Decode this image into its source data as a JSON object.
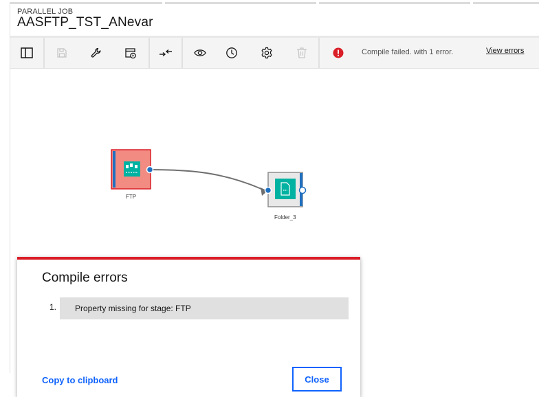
{
  "header": {
    "job_type": "PARALLEL JOB",
    "job_name": "AASFTP_TST_ANevar"
  },
  "toolbar": {
    "buttons": [
      {
        "name": "toggle-panel",
        "icon": "panel-left-icon"
      },
      {
        "name": "save",
        "icon": "save-icon",
        "disabled": true
      },
      {
        "name": "settings-wrench",
        "icon": "wrench-icon"
      },
      {
        "name": "compile-run",
        "icon": "run-job-icon"
      },
      {
        "name": "arrange",
        "icon": "arrows-compress-icon"
      },
      {
        "name": "preview",
        "icon": "eye-icon"
      },
      {
        "name": "schedule",
        "icon": "clock-icon"
      },
      {
        "name": "job-settings",
        "icon": "gear-icon"
      },
      {
        "name": "delete",
        "icon": "trash-icon",
        "disabled": true
      }
    ],
    "status_icon": "error-icon",
    "status_text": "Compile failed. with 1 error.",
    "view_errors_label": "View errors"
  },
  "canvas": {
    "nodes": [
      {
        "id": "ftp",
        "label": "FTP",
        "status": "error",
        "icon": "ftp-stage-icon"
      },
      {
        "id": "folder3",
        "label": "Folder_3",
        "status": "ok",
        "icon": "file-icon"
      }
    ],
    "links": [
      {
        "from": "ftp",
        "to": "folder3"
      }
    ]
  },
  "dialog": {
    "title": "Compile errors",
    "errors": [
      {
        "number": "1.",
        "message": "Property missing for stage: FTP"
      }
    ],
    "copy_label": "Copy to clipboard",
    "close_label": "Close"
  },
  "colors": {
    "error_red": "#da1e28",
    "link_blue": "#0f62fe",
    "node_teal": "#00b2a1",
    "error_node_fill": "#f28b82",
    "port_blue": "#1f70c1"
  }
}
